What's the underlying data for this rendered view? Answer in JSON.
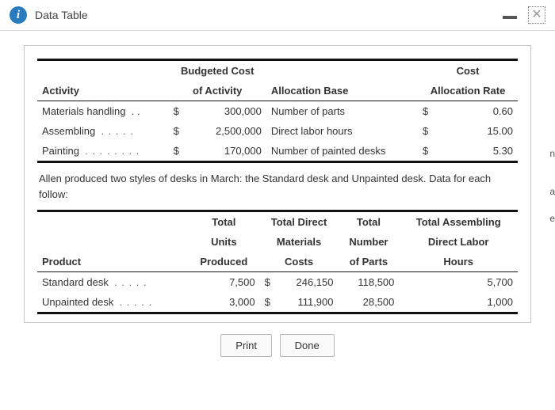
{
  "titlebar": {
    "title": "Data Table"
  },
  "table1": {
    "hdr_activity": "Activity",
    "hdr_budgeted_l1": "Budgeted Cost",
    "hdr_budgeted_l2": "of Activity",
    "hdr_alloc_base": "Allocation Base",
    "hdr_cost_l1": "Cost",
    "hdr_cost_l2": "Allocation Rate",
    "rows": [
      {
        "activity": "Materials handling",
        "sym1": "$",
        "cost": "300,000",
        "base": "Number of parts",
        "sym2": "$",
        "rate": "0.60"
      },
      {
        "activity": "Assembling",
        "sym1": "$",
        "cost": "2,500,000",
        "base": "Direct labor hours",
        "sym2": "$",
        "rate": "15.00"
      },
      {
        "activity": "Painting",
        "sym1": "$",
        "cost": "170,000",
        "base": "Number of painted desks",
        "sym2": "$",
        "rate": "5.30"
      }
    ]
  },
  "paragraph": "Allen produced two styles of desks in March: the Standard desk and Unpainted desk. Data for each follow:",
  "table2": {
    "hdr_product": "Product",
    "hdr_units_l1": "Total",
    "hdr_units_l2": "Units",
    "hdr_units_l3": "Produced",
    "hdr_mat_l1": "Total Direct",
    "hdr_mat_l2": "Materials",
    "hdr_mat_l3": "Costs",
    "hdr_parts_l1": "Total",
    "hdr_parts_l2": "Number",
    "hdr_parts_l3": "of Parts",
    "hdr_dlh_l1": "Total Assembling",
    "hdr_dlh_l2": "Direct Labor",
    "hdr_dlh_l3": "Hours",
    "rows": [
      {
        "product": "Standard desk",
        "units": "7,500",
        "sym": "$",
        "mat": "246,150",
        "parts": "118,500",
        "dlh": "5,700"
      },
      {
        "product": "Unpainted desk",
        "units": "3,000",
        "sym": "$",
        "mat": "111,900",
        "parts": "28,500",
        "dlh": "1,000"
      }
    ]
  },
  "buttons": {
    "print": "Print",
    "done": "Done"
  },
  "edge": {
    "a": "n",
    "b": "a",
    "c": "e"
  }
}
